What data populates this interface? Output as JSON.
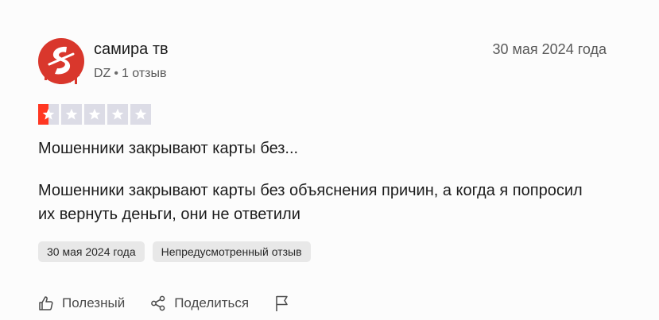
{
  "author": {
    "name": "самира тв",
    "country": "DZ",
    "reviews_count": "1 отзыв"
  },
  "review": {
    "date": "30 мая 2024 года",
    "rating": 1,
    "rating_max": 5,
    "title": "Мошенники закрывают карты без...",
    "body": "Мошенники закрывают карты без объяснения причин, а когда я попросил их вернуть деньги, они не ответили"
  },
  "tags": [
    "30 мая 2024 года",
    "Непредусмотренный отзыв"
  ],
  "actions": {
    "useful_label": "Полезный",
    "share_label": "Поделиться"
  },
  "colors": {
    "star_active": "#ff3722",
    "star_inactive": "#dcdce6",
    "avatar_red": "#d9372c",
    "tag_bg": "#e8e8e8"
  },
  "icons": [
    "avatar-logo-icon",
    "star-icon",
    "thumbs-up-icon",
    "share-icon",
    "flag-icon"
  ]
}
